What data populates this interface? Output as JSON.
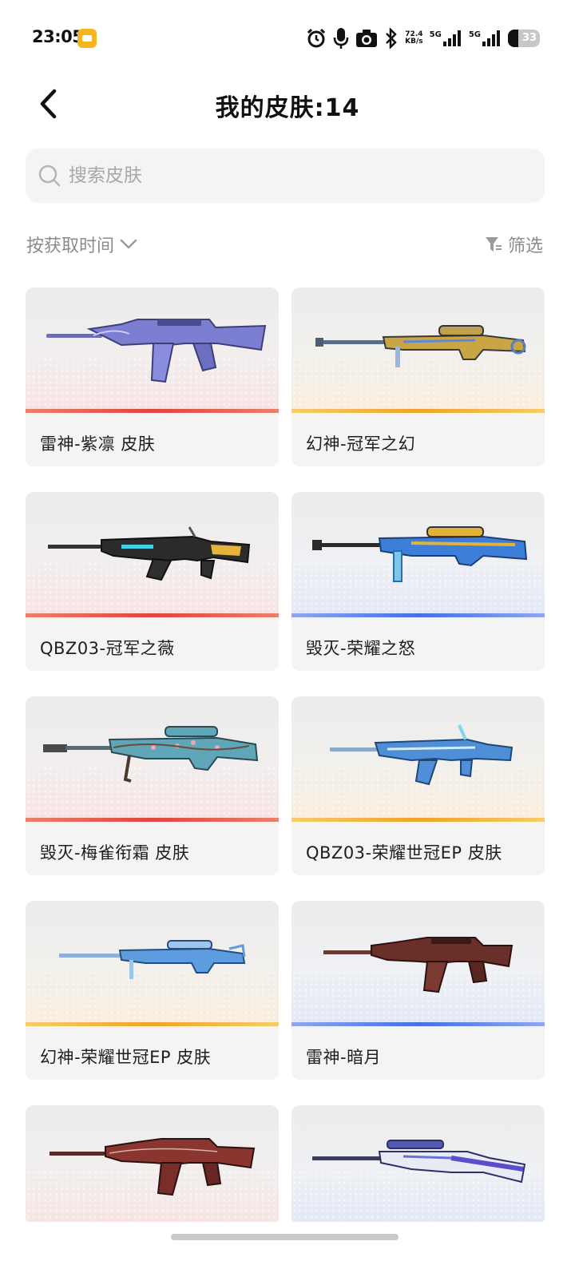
{
  "status_bar": {
    "time": "23:05",
    "net_speed_value": "72.4",
    "net_speed_unit": "KB/s",
    "signal_1_label": "5G",
    "signal_2_label": "5G",
    "battery_level": "33",
    "icons": [
      "alarm-icon",
      "microphone-icon",
      "camera-icon",
      "bluetooth-icon"
    ]
  },
  "header": {
    "title": "我的皮肤:14"
  },
  "search": {
    "placeholder": "搜索皮肤"
  },
  "controls": {
    "sort_label": "按获取时间",
    "filter_label": "筛选"
  },
  "skins": [
    {
      "name": "雷神-紫凛 皮肤",
      "rarity_color": "#e2443b"
    },
    {
      "name": "幻神-冠军之幻",
      "rarity_color": "#f0a328"
    },
    {
      "name": "QBZ03-冠军之薇",
      "rarity_color": "#e2443b"
    },
    {
      "name": "毁灭-荣耀之怒",
      "rarity_color": "#4470e4"
    },
    {
      "name": "毁灭-梅雀衔霜 皮肤",
      "rarity_color": "#e2443b"
    },
    {
      "name": "QBZ03-荣耀世冠EP 皮肤",
      "rarity_color": "#f0a328"
    },
    {
      "name": "幻神-荣耀世冠EP 皮肤",
      "rarity_color": "#f0a328"
    },
    {
      "name": "雷神-暗月",
      "rarity_color": "#4470e4"
    }
  ],
  "colors": {
    "rarity_red": "#e2443b",
    "rarity_gold": "#f0a328",
    "rarity_blue": "#4470e4",
    "card_background": "#f4f4f4"
  }
}
